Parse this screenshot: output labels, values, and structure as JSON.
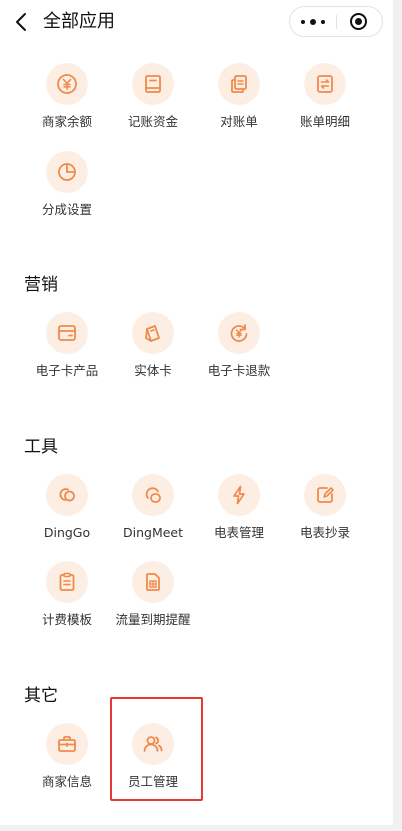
{
  "header": {
    "title": "全部应用"
  },
  "sections": {
    "top": {
      "apps": [
        {
          "label": "商家余额",
          "icon": "yen-coin-icon"
        },
        {
          "label": "记账资金",
          "icon": "ledger-book-icon"
        },
        {
          "label": "对账单",
          "icon": "document-copy-icon"
        },
        {
          "label": "账单明细",
          "icon": "bill-detail-icon"
        },
        {
          "label": "分成设置",
          "icon": "pie-chart-icon"
        }
      ]
    },
    "marketing": {
      "title": "营销",
      "apps": [
        {
          "label": "电子卡产品",
          "icon": "card-wallet-icon"
        },
        {
          "label": "实体卡",
          "icon": "physical-card-icon"
        },
        {
          "label": "电子卡退款",
          "icon": "refund-cycle-icon"
        }
      ]
    },
    "tools": {
      "title": "工具",
      "apps": [
        {
          "label": "DingGo",
          "icon": "dinggo-icon"
        },
        {
          "label": "DingMeet",
          "icon": "dingmeet-icon"
        },
        {
          "label": "电表管理",
          "icon": "lightning-icon"
        },
        {
          "label": "电表抄录",
          "icon": "edit-note-icon"
        },
        {
          "label": "计费模板",
          "icon": "clipboard-icon"
        },
        {
          "label": "流量到期提醒",
          "icon": "sim-card-icon"
        }
      ]
    },
    "other": {
      "title": "其它",
      "apps": [
        {
          "label": "商家信息",
          "icon": "briefcase-icon"
        },
        {
          "label": "员工管理",
          "icon": "users-icon"
        }
      ]
    }
  },
  "colors": {
    "accent": "#f08a4b",
    "icon_bg": "#fdeee3",
    "highlight": "#e53935"
  }
}
